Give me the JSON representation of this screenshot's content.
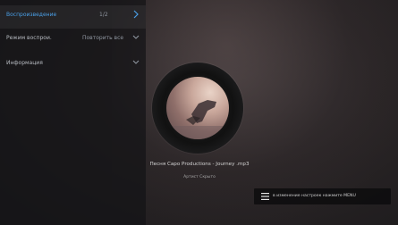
{
  "sidebar": {
    "items": [
      {
        "label": "Воспроизведение",
        "value": "1/2",
        "accent": "#4a9fe6",
        "label_color": "#4a9fe6",
        "chevron": "chevron-right-icon"
      },
      {
        "label": "Режим воспрои.",
        "value": "Повторить все",
        "chevron": "chevron-down-icon"
      },
      {
        "label": "Информация",
        "value": "",
        "chevron": "chevron-down-icon"
      }
    ]
  },
  "player": {
    "title": "Песня Capo Productions - Journey .mp3",
    "artist": "Артист Скрыто"
  },
  "hint": {
    "icon": "menu-icon",
    "text": "в изменение настроек нажмите MENU"
  }
}
